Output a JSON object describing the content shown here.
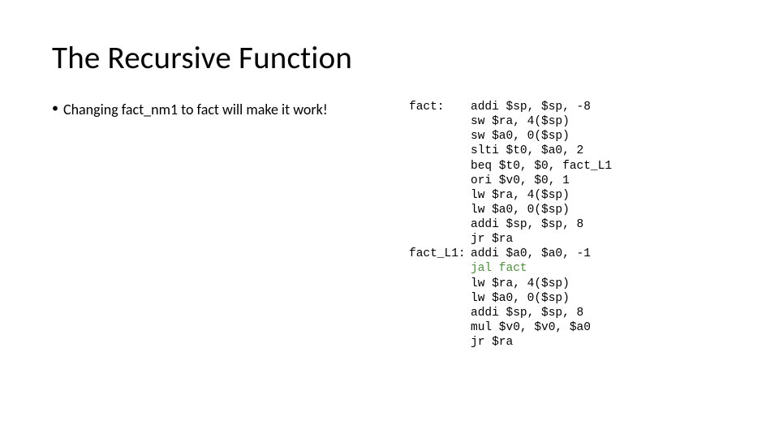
{
  "title": "The Recursive Function",
  "bullet_text": "Changing fact_nm1 to fact will make it work!",
  "code": {
    "lines": [
      {
        "label": "fact:",
        "instr": "addi $sp, $sp, -8",
        "green": false
      },
      {
        "label": "",
        "instr": "sw $ra, 4($sp)",
        "green": false
      },
      {
        "label": "",
        "instr": "sw $a0, 0($sp)",
        "green": false
      },
      {
        "label": "",
        "instr": "slti $t0, $a0, 2",
        "green": false
      },
      {
        "label": "",
        "instr": "beq $t0, $0, fact_L1",
        "green": false
      },
      {
        "label": "",
        "instr": "ori $v0, $0, 1",
        "green": false
      },
      {
        "label": "",
        "instr": "lw $ra, 4($sp)",
        "green": false
      },
      {
        "label": "",
        "instr": "lw $a0, 0($sp)",
        "green": false
      },
      {
        "label": "",
        "instr": "addi $sp, $sp, 8",
        "green": false
      },
      {
        "label": "",
        "instr": "jr $ra",
        "green": false
      },
      {
        "label": "fact_L1:",
        "instr": "addi $a0, $a0, -1",
        "green": false
      },
      {
        "label": "",
        "instr": "jal fact",
        "green": true
      },
      {
        "label": "",
        "instr": "lw $ra, 4($sp)",
        "green": false
      },
      {
        "label": "",
        "instr": "lw $a0, 0($sp)",
        "green": false
      },
      {
        "label": "",
        "instr": "addi $sp, $sp, 8",
        "green": false
      },
      {
        "label": "",
        "instr": "mul $v0, $v0, $a0",
        "green": false
      },
      {
        "label": "",
        "instr": "jr $ra",
        "green": false
      }
    ]
  }
}
